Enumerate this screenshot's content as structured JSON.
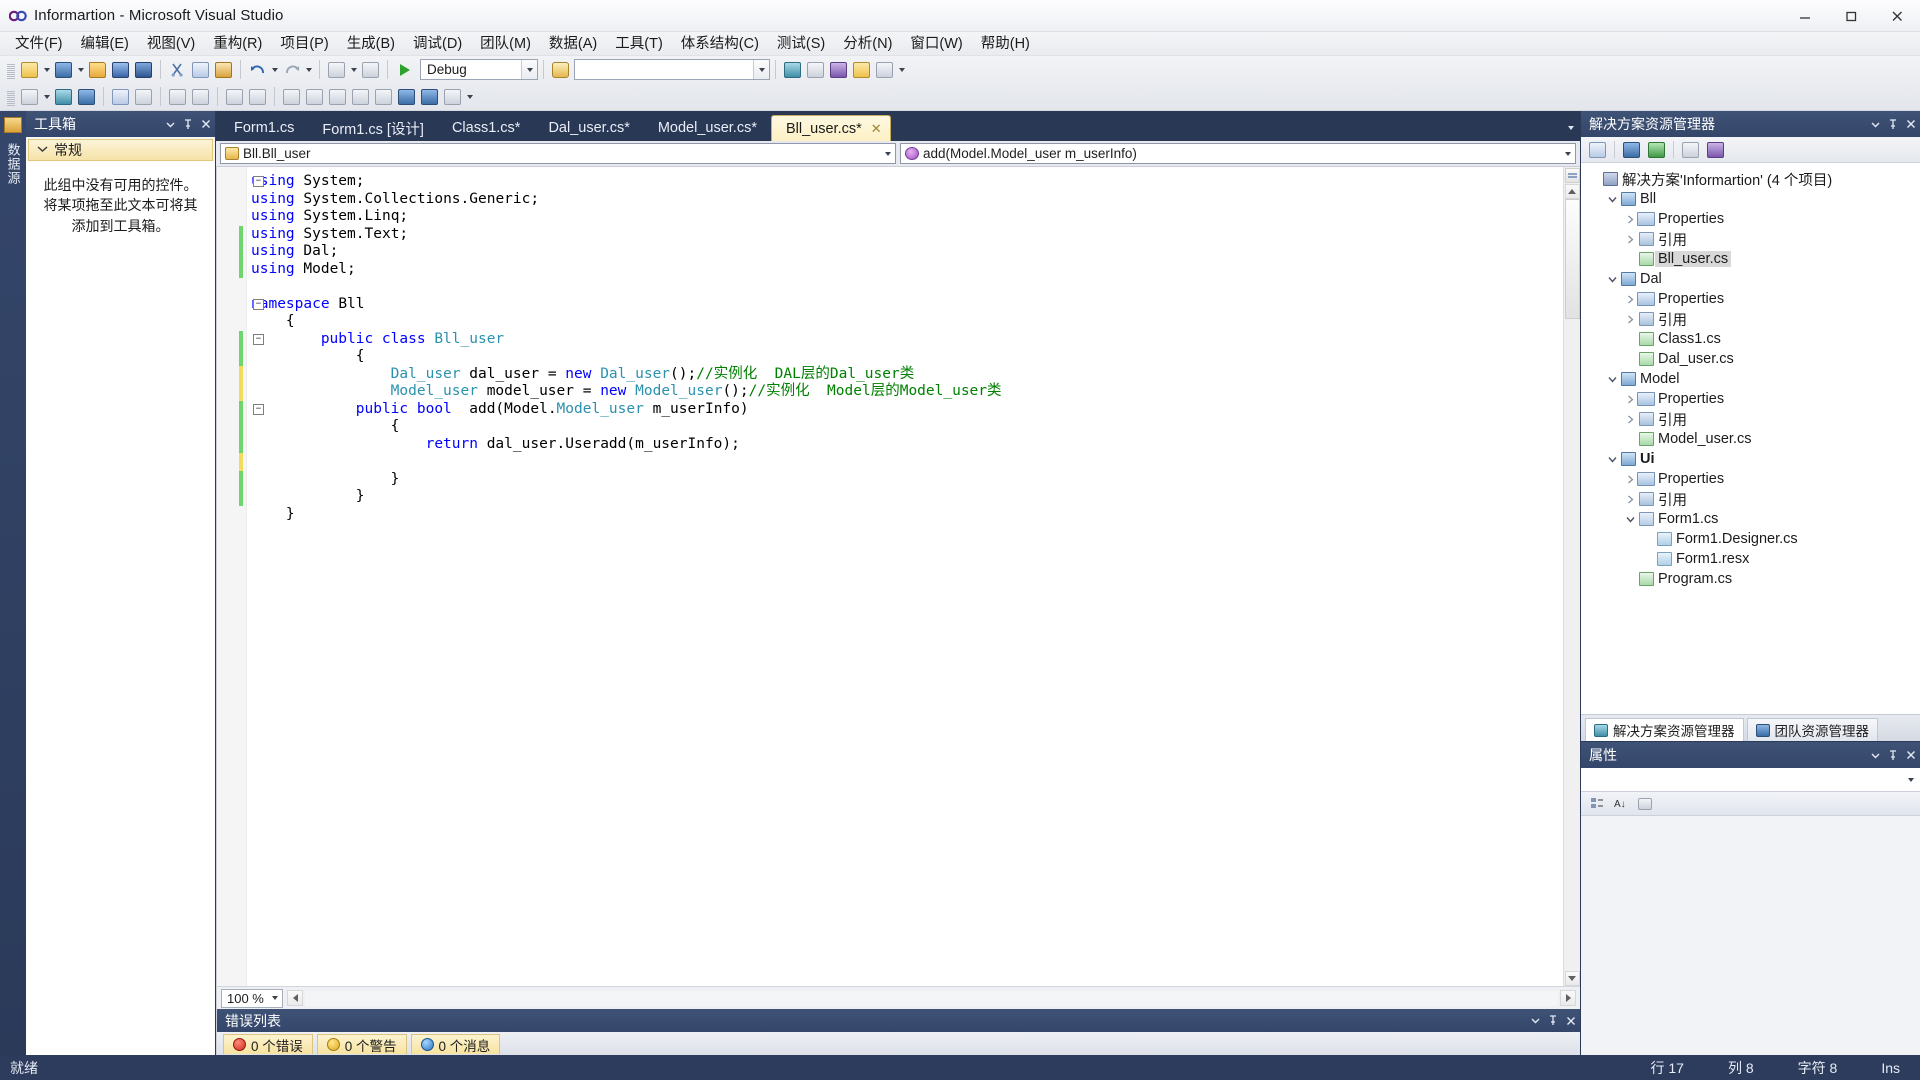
{
  "window": {
    "title": "Informartion - Microsoft Visual Studio",
    "logo_icon": "vs-logo-icon",
    "minimize_label": "─",
    "maximize_label": "❐",
    "close_label": "✕"
  },
  "menu": {
    "items": [
      {
        "label": "文件(F)"
      },
      {
        "label": "编辑(E)"
      },
      {
        "label": "视图(V)"
      },
      {
        "label": "重构(R)"
      },
      {
        "label": "项目(P)"
      },
      {
        "label": "生成(B)"
      },
      {
        "label": "调试(D)"
      },
      {
        "label": "团队(M)"
      },
      {
        "label": "数据(A)"
      },
      {
        "label": "工具(T)"
      },
      {
        "label": "体系结构(C)"
      },
      {
        "label": "测试(S)"
      },
      {
        "label": "分析(N)"
      },
      {
        "label": "窗口(W)"
      },
      {
        "label": "帮助(H)"
      }
    ]
  },
  "toolbar": {
    "config_value": "Debug",
    "search_value": "",
    "zoom_value": "100 %"
  },
  "toolbox": {
    "title": "工具箱",
    "group_label": "常规",
    "empty_text": "此组中没有可用的控件。将某项拖至此文本可将其添加到工具箱。",
    "dock_strip_label": "数据源"
  },
  "tabs": [
    {
      "label": "Form1.cs",
      "active": false
    },
    {
      "label": "Form1.cs [设计]",
      "active": false
    },
    {
      "label": "Class1.cs*",
      "active": false
    },
    {
      "label": "Dal_user.cs*",
      "active": false
    },
    {
      "label": "Model_user.cs*",
      "active": false
    },
    {
      "label": "Bll_user.cs*",
      "active": true,
      "close_label": "✕"
    }
  ],
  "navbar": {
    "type_value": "Bll.Bll_user",
    "member_value": "add(Model.Model_user m_userInfo)"
  },
  "code": {
    "lines": [
      {
        "indent": 0,
        "marker": "",
        "fold": "minus",
        "tokens": [
          {
            "t": "k",
            "v": "using "
          },
          {
            "t": "p",
            "v": "System;"
          }
        ]
      },
      {
        "indent": 0,
        "marker": "",
        "fold": "",
        "tokens": [
          {
            "t": "k",
            "v": "using "
          },
          {
            "t": "p",
            "v": "System.Collections.Generic;"
          }
        ]
      },
      {
        "indent": 0,
        "marker": "",
        "fold": "",
        "tokens": [
          {
            "t": "k",
            "v": "using "
          },
          {
            "t": "p",
            "v": "System.Linq;"
          }
        ]
      },
      {
        "indent": 0,
        "marker": "green",
        "fold": "",
        "tokens": [
          {
            "t": "k",
            "v": "using "
          },
          {
            "t": "p",
            "v": "System.Text;"
          }
        ]
      },
      {
        "indent": 0,
        "marker": "green",
        "fold": "",
        "tokens": [
          {
            "t": "k",
            "v": "using "
          },
          {
            "t": "p",
            "v": "Dal;"
          }
        ]
      },
      {
        "indent": 0,
        "marker": "green",
        "fold": "",
        "tokens": [
          {
            "t": "k",
            "v": "using "
          },
          {
            "t": "p",
            "v": "Model;"
          }
        ]
      },
      {
        "indent": 0,
        "marker": "",
        "fold": "",
        "tokens": []
      },
      {
        "indent": 0,
        "marker": "",
        "fold": "minus",
        "tokens": [
          {
            "t": "k",
            "v": "namespace "
          },
          {
            "t": "p",
            "v": "Bll"
          }
        ]
      },
      {
        "indent": 1,
        "marker": "",
        "fold": "",
        "tokens": [
          {
            "t": "p",
            "v": "{"
          }
        ]
      },
      {
        "indent": 2,
        "marker": "green",
        "fold": "minus",
        "tokens": [
          {
            "t": "k",
            "v": "public class "
          },
          {
            "t": "t",
            "v": "Bll_user"
          }
        ]
      },
      {
        "indent": 3,
        "marker": "green",
        "fold": "",
        "tokens": [
          {
            "t": "p",
            "v": "{"
          }
        ]
      },
      {
        "indent": 4,
        "marker": "yellow",
        "fold": "",
        "tokens": [
          {
            "t": "t",
            "v": "Dal_user "
          },
          {
            "t": "p",
            "v": "dal_user = "
          },
          {
            "t": "k",
            "v": "new "
          },
          {
            "t": "t",
            "v": "Dal_user"
          },
          {
            "t": "p",
            "v": "();"
          },
          {
            "t": "c",
            "v": "//实例化  DAL层的Dal_user类"
          }
        ]
      },
      {
        "indent": 4,
        "marker": "yellow",
        "fold": "",
        "tokens": [
          {
            "t": "t",
            "v": "Model_user "
          },
          {
            "t": "p",
            "v": "model_user = "
          },
          {
            "t": "k",
            "v": "new "
          },
          {
            "t": "t",
            "v": "Model_user"
          },
          {
            "t": "p",
            "v": "();"
          },
          {
            "t": "c",
            "v": "//实例化  Model层的Model_user类"
          }
        ]
      },
      {
        "indent": 3,
        "marker": "green",
        "fold": "minus",
        "tokens": [
          {
            "t": "k",
            "v": "public bool "
          },
          {
            "t": "p",
            "v": " add(Model."
          },
          {
            "t": "t",
            "v": "Model_user"
          },
          {
            "t": "p",
            "v": " m_userInfo)"
          }
        ]
      },
      {
        "indent": 4,
        "marker": "green",
        "fold": "",
        "tokens": [
          {
            "t": "p",
            "v": "{"
          }
        ]
      },
      {
        "indent": 5,
        "marker": "green",
        "fold": "",
        "tokens": [
          {
            "t": "k",
            "v": "return "
          },
          {
            "t": "p",
            "v": "dal_user.Useradd(m_userInfo);"
          }
        ]
      },
      {
        "indent": 0,
        "marker": "yellow",
        "fold": "",
        "tokens": []
      },
      {
        "indent": 4,
        "marker": "green",
        "fold": "",
        "tokens": [
          {
            "t": "p",
            "v": "}"
          }
        ]
      },
      {
        "indent": 3,
        "marker": "green",
        "fold": "",
        "tokens": [
          {
            "t": "p",
            "v": "}"
          }
        ]
      },
      {
        "indent": 1,
        "marker": "",
        "fold": "",
        "tokens": [
          {
            "t": "p",
            "v": "}"
          }
        ]
      }
    ]
  },
  "errorlist": {
    "title": "错误列表",
    "chips": [
      {
        "icon": "error-icon",
        "label": "0 个错误"
      },
      {
        "icon": "warning-icon",
        "label": "0 个警告"
      },
      {
        "icon": "info-icon",
        "label": "0 个消息"
      }
    ]
  },
  "solution_explorer": {
    "title": "解决方案资源管理器",
    "tree": [
      {
        "level": 0,
        "expander": "",
        "icon": "solution-icon",
        "label": "解决方案'Informartion' (4 个项目)",
        "selected": false,
        "bold": false
      },
      {
        "level": 1,
        "expander": "down",
        "icon": "project-icon",
        "label": "Bll",
        "selected": false,
        "bold": false
      },
      {
        "level": 2,
        "expander": "right",
        "icon": "properties-icon",
        "label": "Properties",
        "selected": false,
        "bold": false
      },
      {
        "level": 2,
        "expander": "right",
        "icon": "references-icon",
        "label": "引用",
        "selected": false,
        "bold": false
      },
      {
        "level": 2,
        "expander": "",
        "icon": "csharp-file-icon",
        "label": "Bll_user.cs",
        "selected": true,
        "bold": false
      },
      {
        "level": 1,
        "expander": "down",
        "icon": "project-icon",
        "label": "Dal",
        "selected": false,
        "bold": false
      },
      {
        "level": 2,
        "expander": "right",
        "icon": "properties-icon",
        "label": "Properties",
        "selected": false,
        "bold": false
      },
      {
        "level": 2,
        "expander": "right",
        "icon": "references-icon",
        "label": "引用",
        "selected": false,
        "bold": false
      },
      {
        "level": 2,
        "expander": "",
        "icon": "csharp-file-icon",
        "label": "Class1.cs",
        "selected": false,
        "bold": false
      },
      {
        "level": 2,
        "expander": "",
        "icon": "csharp-file-icon",
        "label": "Dal_user.cs",
        "selected": false,
        "bold": false
      },
      {
        "level": 1,
        "expander": "down",
        "icon": "project-icon",
        "label": "Model",
        "selected": false,
        "bold": false
      },
      {
        "level": 2,
        "expander": "right",
        "icon": "properties-icon",
        "label": "Properties",
        "selected": false,
        "bold": false
      },
      {
        "level": 2,
        "expander": "right",
        "icon": "references-icon",
        "label": "引用",
        "selected": false,
        "bold": false
      },
      {
        "level": 2,
        "expander": "",
        "icon": "csharp-file-icon",
        "label": "Model_user.cs",
        "selected": false,
        "bold": false
      },
      {
        "level": 1,
        "expander": "down",
        "icon": "project-icon",
        "label": "Ui",
        "selected": false,
        "bold": true
      },
      {
        "level": 2,
        "expander": "right",
        "icon": "properties-icon",
        "label": "Properties",
        "selected": false,
        "bold": false
      },
      {
        "level": 2,
        "expander": "right",
        "icon": "references-icon",
        "label": "引用",
        "selected": false,
        "bold": false
      },
      {
        "level": 2,
        "expander": "down",
        "icon": "form-icon",
        "label": "Form1.cs",
        "selected": false,
        "bold": false
      },
      {
        "level": 3,
        "expander": "",
        "icon": "designer-file-icon",
        "label": "Form1.Designer.cs",
        "selected": false,
        "bold": false
      },
      {
        "level": 3,
        "expander": "",
        "icon": "resx-file-icon",
        "label": "Form1.resx",
        "selected": false,
        "bold": false
      },
      {
        "level": 2,
        "expander": "",
        "icon": "csharp-file-icon",
        "label": "Program.cs",
        "selected": false,
        "bold": false
      }
    ],
    "bottom_tabs": [
      {
        "label": "解决方案资源管理器",
        "icon": "solution-explorer-icon",
        "active": true
      },
      {
        "label": "团队资源管理器",
        "icon": "team-explorer-icon",
        "active": false
      }
    ]
  },
  "properties_panel": {
    "title": "属性"
  },
  "statusbar": {
    "state": "就绪",
    "line": "行 17",
    "column": "列 8",
    "character": "字符 8",
    "insert_mode": "Ins"
  }
}
